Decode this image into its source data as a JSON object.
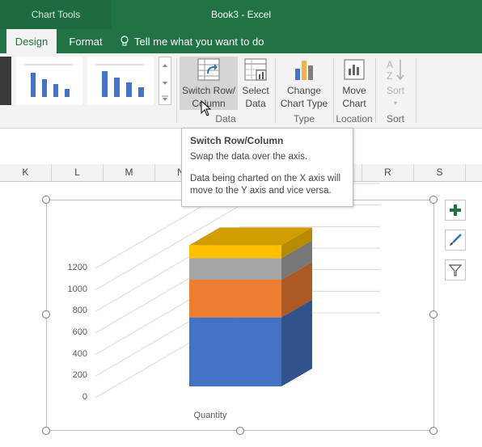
{
  "titlebar": {
    "context_tab": "Chart Tools",
    "window_title": "Book3  -  Excel"
  },
  "tabs": {
    "design": "Design",
    "format": "Format",
    "tell_me": "Tell me what you want to do"
  },
  "ribbon": {
    "switch_row_col": {
      "line1": "Switch Row/",
      "line2": "Column"
    },
    "select_data": {
      "line1": "Select",
      "line2": "Data"
    },
    "change_chart_type": {
      "line1": "Change",
      "line2": "Chart Type"
    },
    "move_chart": {
      "line1": "Move",
      "line2": "Chart"
    },
    "sort": {
      "label": "Sort"
    },
    "groups": {
      "data": "Data",
      "type": "Type",
      "location": "Location",
      "sort": "Sort"
    }
  },
  "columns": [
    "K",
    "L",
    "M",
    "N",
    "R",
    "S"
  ],
  "tooltip": {
    "title": "Switch Row/Column",
    "line1": "Swap the data over the axis.",
    "line2": "Data being charted on the X axis will",
    "line3": "move to the Y axis and vice versa."
  },
  "chart_data": {
    "type": "bar",
    "categories": [
      "Quantity"
    ],
    "y_ticks": [
      "1200",
      "1000",
      "800",
      "600",
      "400",
      "200",
      "0"
    ],
    "ylim": [
      0,
      1200
    ],
    "stacked": true,
    "series": [
      {
        "values": [
          640
        ],
        "color": "#4472C4"
      },
      {
        "values": [
          350
        ],
        "color": "#ED7D31"
      },
      {
        "values": [
          200
        ],
        "color": "#A5A5A5"
      },
      {
        "values": [
          120
        ],
        "color": "#FFC000"
      }
    ]
  }
}
